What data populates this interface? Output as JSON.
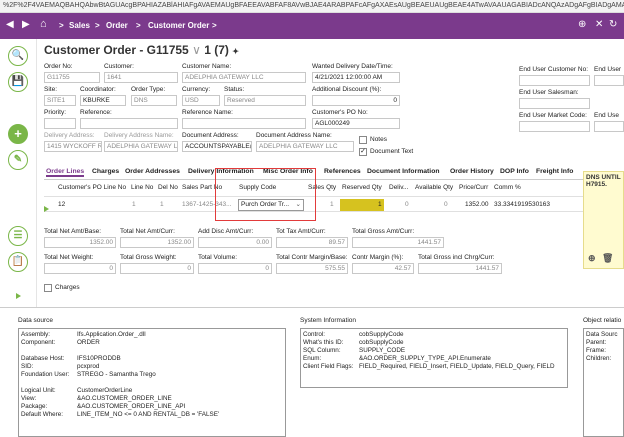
{
  "browser": {
    "url": "%2F%2F4VAEMAQBAHQAbwBtAGUAcgBPAHIAZABlAHIAFgAVAEMAUgBFAEEAVABFAF8AVwBJAE4ARABPAFcAFgAXAEsAUgBEAEUAUgBEAE4ATwAVAAUAGABIADcANQAzADgAFgBIADgAMAA2ADUAFgBsA"
  },
  "nav": {
    "back": "◀",
    "forward": "▶",
    "home": "⌂",
    "breadcrumb": [
      "Sales",
      "Order",
      "Customer Order"
    ],
    "sep": ">",
    "right_icons": [
      "⊕",
      "✕",
      "↻"
    ]
  },
  "header": {
    "title": "Customer Order - G11755",
    "counter": "1 (7)",
    "pin": "📌"
  },
  "sidebar": {
    "icons": [
      "🔍",
      "💾",
      "+",
      "✎",
      "☰",
      "📋",
      "▦",
      "⊞"
    ]
  },
  "form": {
    "order_no": {
      "label": "Order No:",
      "value": "G11755"
    },
    "customer": {
      "label": "Customer:",
      "value": "1641"
    },
    "customer_name": {
      "label": "Customer Name:",
      "value": "ADELPHIA GATEWAY LLC"
    },
    "wanted_date": {
      "label": "Wanted Delivery Date/Time:",
      "value": "4/21/2021 12:00:00 AM"
    },
    "site": {
      "label": "Site:",
      "value": "SITE1"
    },
    "coordinator": {
      "label": "Coordinator:",
      "value": "KBURKE"
    },
    "order_type": {
      "label": "Order Type:",
      "value": "DNS"
    },
    "currency": {
      "label": "Currency:",
      "value": "USD"
    },
    "status": {
      "label": "Status:",
      "value": "Reserved"
    },
    "add_discount": {
      "label": "Additional Discount (%):",
      "value": "0"
    },
    "priority": {
      "label": "Priority:",
      "value": ""
    },
    "reference": {
      "label": "Reference:",
      "value": ""
    },
    "reference_name": {
      "label": "Reference Name:",
      "value": ""
    },
    "customer_po": {
      "label": "Customer's PO No:",
      "value": "AGL000249"
    },
    "delivery_address": {
      "label": "Delivery Address:",
      "value": "1415 WYCKOFF RD"
    },
    "delivery_address_name": {
      "label": "Delivery Address Name:",
      "value": "ADELPHIA GATEWAY LLC"
    },
    "document_address": {
      "label": "Document Address:",
      "value": "ACCOUNTSPAYABLE@N"
    },
    "document_address_name": {
      "label": "Document Address Name:",
      "value": "ADELPHIA GATEWAY LLC"
    },
    "notes_label": "Notes",
    "document_text_label": "Document Text",
    "end_user_customer_no": "End User Customer No:",
    "end_user": "End User",
    "end_user_salesman": "End User Salesman:",
    "end_user_market_code": "End User Market Code:",
    "end_user_2": "End Use"
  },
  "tabs": [
    "Order Lines",
    "Charges",
    "Order Addresses",
    "Delivery Information",
    "Misc Order Info",
    "References",
    "Document Information",
    "Order History",
    "DOP Info",
    "Freight Info"
  ],
  "grid": {
    "columns": [
      "Customer's PO Line No",
      "Line No",
      "Del No",
      "Sales Part No",
      "Supply Code",
      "Sales Qty",
      "Reserved Qty",
      "Deliv...",
      "Available Qty",
      "Price/Curr",
      "Comm %"
    ],
    "row": {
      "po_line": "12",
      "line_no": "1",
      "del_no": "1",
      "sales_part": "1367-1425-343...",
      "supply_code": "Purch Order Tr...",
      "sales_qty": "1",
      "reserved_qty": "1",
      "deliv": "0",
      "available_qty": "0",
      "price": "1352.00",
      "comm": "33.3341919530163"
    }
  },
  "totals": {
    "net_amt_base": {
      "label": "Total Net Amt/Base:",
      "value": "1352.00"
    },
    "net_amt_curr": {
      "label": "Total Net Amt/Curr:",
      "value": "1352.00"
    },
    "add_disc": {
      "label": "Add Disc Amt/Curr:",
      "value": "0.00"
    },
    "tax_amt": {
      "label": "Tot Tax Amt/Curr:",
      "value": "89.57"
    },
    "gross_amt": {
      "label": "Total Gross Amt/Curr:",
      "value": "1441.57"
    },
    "net_weight": {
      "label": "Total Net Weight:",
      "value": "0"
    },
    "gross_weight": {
      "label": "Total Gross Weight:",
      "value": "0"
    },
    "volume": {
      "label": "Total Volume:",
      "value": "0"
    },
    "contr_margin_base": {
      "label": "Total Contr Margin/Base:",
      "value": "575.55"
    },
    "contr_margin_pct": {
      "label": "Contr Margin (%):",
      "value": "42.57"
    },
    "gross_incl": {
      "label": "Total Gross incl Chrg/Curr:",
      "value": "1441.57"
    },
    "charges_label": "Charges"
  },
  "note": {
    "text": "DNS UNTIL H7915."
  },
  "panels": {
    "data_source": {
      "title": "Data source",
      "lines": [
        [
          "Assembly:",
          "Ifs.Application.Order_.dll"
        ],
        [
          "Component:",
          "ORDER"
        ],
        [
          "",
          ""
        ],
        [
          "Database Host:",
          "IFS10PRODDB"
        ],
        [
          "SID:",
          "pcxprod"
        ],
        [
          "Foundation User:",
          "STREGO - Samantha Trego"
        ],
        [
          "",
          ""
        ],
        [
          "Logical Unit:",
          "CustomerOrderLine"
        ],
        [
          "View:",
          "&AO.CUSTOMER_ORDER_LINE"
        ],
        [
          "Package:",
          "&AO.CUSTOMER_ORDER_LINE_API"
        ],
        [
          "Default Where:",
          "LINE_ITEM_NO <= 0 AND RENTAL_DB = 'FALSE'"
        ]
      ]
    },
    "system_info": {
      "title": "System Information",
      "lines": [
        [
          "Control:",
          "cobSupplyCode"
        ],
        [
          "What's this ID:",
          "cobSupplyCode"
        ],
        [
          "SQL Column:",
          "SUPPLY_CODE"
        ],
        [
          "Enum:",
          "&AO.ORDER_SUPPLY_TYPE_API.Enumerate"
        ],
        [
          "Client Field Flags:",
          "FIELD_Required, FIELD_Insert, FIELD_Update, FIELD_Query, FIELD"
        ]
      ]
    },
    "object_relations": {
      "title": "Object relatio",
      "lines": [
        [
          "Data Sourc",
          ""
        ],
        [
          "Parent:",
          ""
        ],
        [
          "Frame:",
          ""
        ],
        [
          "Children:",
          ""
        ]
      ]
    }
  }
}
